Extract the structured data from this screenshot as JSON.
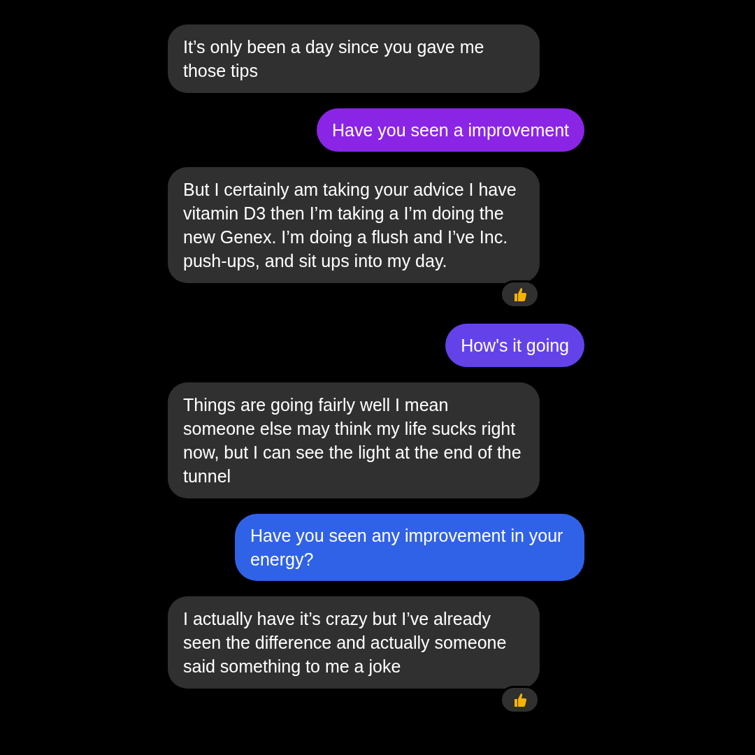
{
  "messages": [
    {
      "kind": "received",
      "text": "It’s only been a day since you gave me those tips",
      "reacted": false
    },
    {
      "kind": "sent",
      "text": "Have you seen a improvement",
      "color": "#8a25e6",
      "reacted": false
    },
    {
      "kind": "received",
      "text": "But I certainly am taking your advice I have vitamin D3 then I’m taking a I’m doing the new Genex. I’m doing a flush and I’ve Inc. push-ups, and sit ups into my day.",
      "reacted": true
    },
    {
      "kind": "sent",
      "text": "How's it going",
      "color": "#6342ea",
      "reacted": false
    },
    {
      "kind": "received",
      "text": "Things are going fairly well I mean someone else may think my life sucks right now, but I can see the light at the end of the tunnel",
      "reacted": false
    },
    {
      "kind": "sent",
      "text": "Have you seen any improvement in your energy?",
      "color": "#3062e8",
      "reacted": false
    },
    {
      "kind": "received",
      "text": "I actually have it’s crazy but I’ve already seen the difference and actually someone said something to me a joke",
      "reacted": true
    }
  ]
}
